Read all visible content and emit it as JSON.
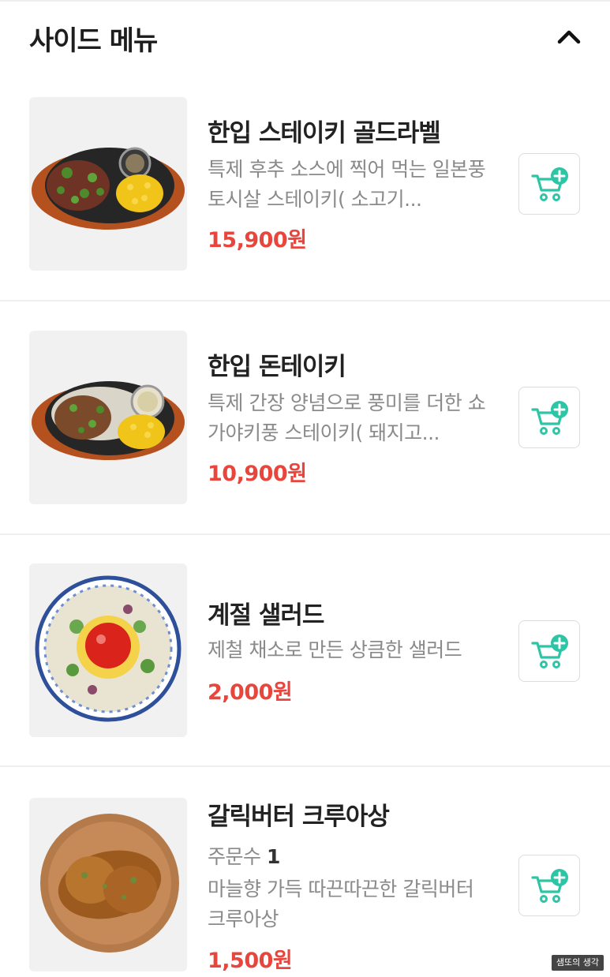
{
  "section": {
    "title": "사이드 메뉴",
    "collapse_icon": "chevron-up-icon"
  },
  "items": [
    {
      "name": "한입 스테이키 골드라벨",
      "description": "특제 후추 소스에 찍어 먹는 일본풍 토시살 스테이키( 소고기...",
      "price": "15,900원",
      "image": "steak-on-sizzling-plate"
    },
    {
      "name": "한입 돈테이키",
      "description": "특제 간장 양념으로 풍미를 더한 쇼가야키풍 스테이키( 돼지고...",
      "price": "10,900원",
      "image": "pork-steak-on-sizzling-plate"
    },
    {
      "name": "계절 샐러드",
      "description": "제철 채소로 만든 상큼한 샐러드",
      "price": "2,000원",
      "image": "salad-bowl"
    },
    {
      "name": "갈릭버터 크루아상",
      "orders_label": "주문수",
      "orders_count": "1",
      "description": "마늘향 가득 따끈따끈한 갈릭버터 크루아상",
      "price": "1,500원",
      "image": "croissant-on-board"
    }
  ],
  "cart_icon": "add-to-cart-icon",
  "colors": {
    "price": "#e8453c",
    "accent": "#2ec4a6",
    "text_primary": "#222222",
    "text_secondary": "#8a8a8a"
  },
  "watermark": "샘또의 생각"
}
